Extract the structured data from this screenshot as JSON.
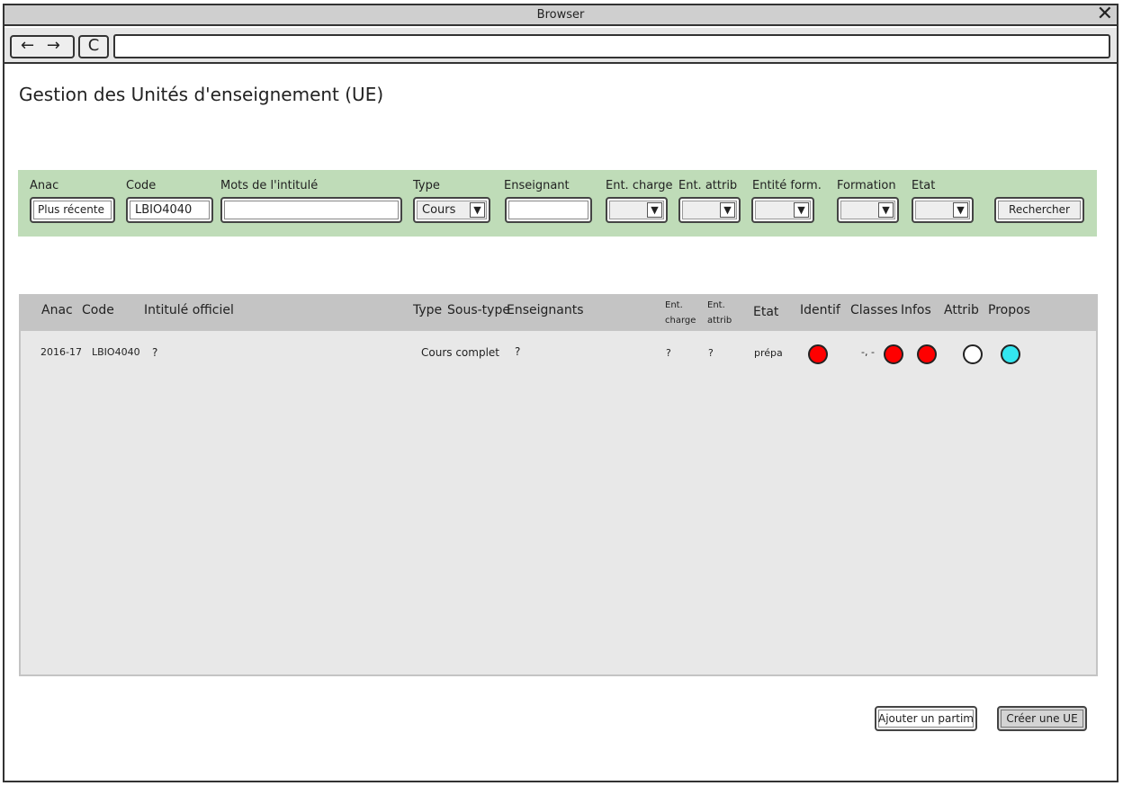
{
  "browser": {
    "title": "Browser",
    "close_icon": "close-icon",
    "nav_arrows": "← →",
    "reload": "C",
    "url": ""
  },
  "page": {
    "title": "Gestion des Unités d'enseignement (UE)"
  },
  "filters": {
    "anac": {
      "label": "Anac",
      "value": "Plus récente"
    },
    "code": {
      "label": "Code",
      "value": "LBIO4040"
    },
    "mots": {
      "label": "Mots de l'intitulé",
      "value": ""
    },
    "type": {
      "label": "Type",
      "value": "Cours"
    },
    "enseignant": {
      "label": "Enseignant",
      "value": ""
    },
    "ent_charge": {
      "label": "Ent. charge",
      "value": ""
    },
    "ent_attrib": {
      "label": "Ent. attrib",
      "value": ""
    },
    "entite_form": {
      "label": "Entité form.",
      "value": ""
    },
    "formation": {
      "label": "Formation",
      "value": ""
    },
    "etat": {
      "label": "Etat",
      "value": ""
    },
    "search_button": "Rechercher"
  },
  "table": {
    "headers": {
      "anac": "Anac",
      "code": "Code",
      "intitule": "Intitulé officiel",
      "type": "Type",
      "sous_type": "Sous-type",
      "enseignants": "Enseignants",
      "ent_charge_1": "Ent.",
      "ent_charge_2": "charge",
      "ent_attrib_1": "Ent.",
      "ent_attrib_2": "attrib",
      "etat": "Etat",
      "identif": "Identif",
      "classes": "Classes",
      "infos": "Infos",
      "attrib": "Attrib",
      "propos": "Propos"
    },
    "rows": [
      {
        "anac": "2016-17",
        "code": "LBIO4040",
        "intitule": "?",
        "type_soustype": "Cours complet",
        "enseignants": "?",
        "ent_charge": "?",
        "ent_attrib": "?",
        "etat": "prépa",
        "classes_text": "-, -",
        "status_colors": {
          "identif": "#ff0000",
          "classes": "#ff0000",
          "infos": "#ff0000",
          "attrib": "#ffffff",
          "propos": "#33e6f0"
        }
      }
    ]
  },
  "actions": {
    "add_button": "Ajouter un partim",
    "create_button": "Créer une UE"
  }
}
